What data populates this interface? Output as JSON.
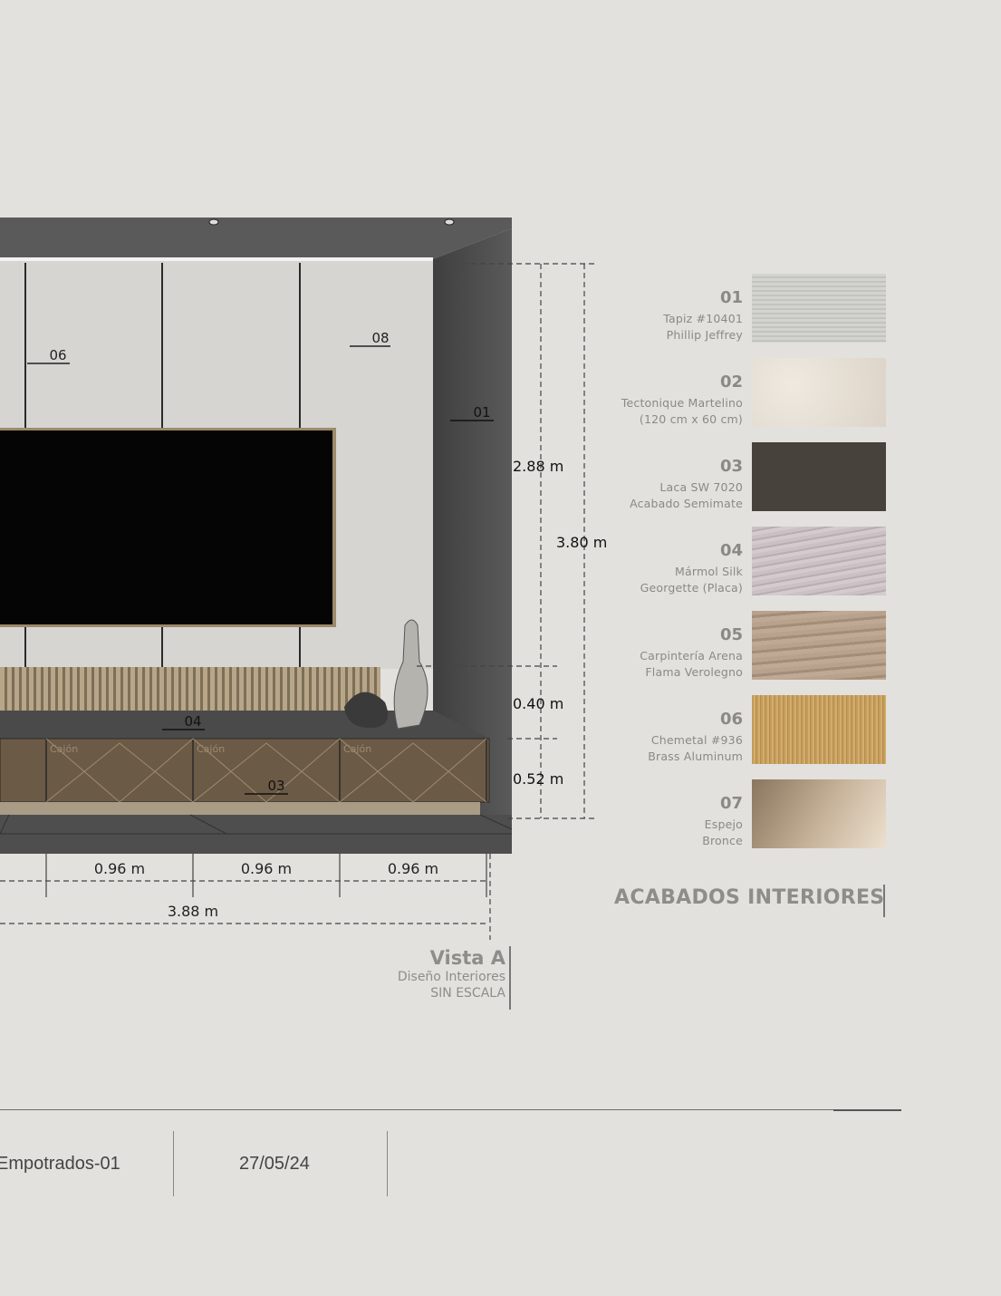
{
  "elevation": {
    "panel_tags": [
      "06",
      "08",
      "01",
      "04",
      "03"
    ],
    "drawer_labels": [
      "Cajón",
      "Cajón",
      "Cajón"
    ],
    "dimensions": {
      "wall_panel_height": "2.88 m",
      "total_height": "3.80 m",
      "slat_height": "0.40 m",
      "cabinet_height": "0.52 m",
      "drawer_widths": [
        "0.96 m",
        "0.96 m",
        "0.96 m"
      ],
      "total_width": "3.88 m"
    },
    "colors": {
      "wall": "#d6d5d2",
      "side_wall": "#4d4d4d",
      "ceiling": "#5a5a5a",
      "tv": "#050505",
      "cabinet": "#6b5a45",
      "slats": "#a99777",
      "floor": "#4e4e4e"
    }
  },
  "finishes": {
    "title": "ACABADOS INTERIORES",
    "items": [
      {
        "code": "01",
        "line1": "Tapiz  #10401",
        "line2": "Phillip Jeffrey",
        "color": "#cfd0cb"
      },
      {
        "code": "02",
        "line1": "Tectonique Martelino",
        "line2": "(120 cm x 60 cm)",
        "color": "#e3ddd3"
      },
      {
        "code": "03",
        "line1": "Laca  SW 7020",
        "line2": "Acabado Semimate",
        "color": "#48423d"
      },
      {
        "code": "04",
        "line1": "Mármol Silk",
        "line2": "Georgette (Placa)",
        "color": "#c7bcc0"
      },
      {
        "code": "05",
        "line1": "Carpintería Arena",
        "line2": "Flama Verolegno",
        "color": "#b29c87"
      },
      {
        "code": "06",
        "line1": "Chemetal #936",
        "line2": "Brass Aluminum",
        "color": "#c49c5c"
      },
      {
        "code": "07",
        "line1": "Espejo",
        "line2": "Bronce",
        "color": "#a68f74"
      }
    ]
  },
  "view": {
    "title": "Vista A",
    "subtitle": "Diseño Interiores",
    "scale": "SIN ESCALA"
  },
  "footer": {
    "drawing_name": "Empotrados-01",
    "date": "27/05/24"
  }
}
